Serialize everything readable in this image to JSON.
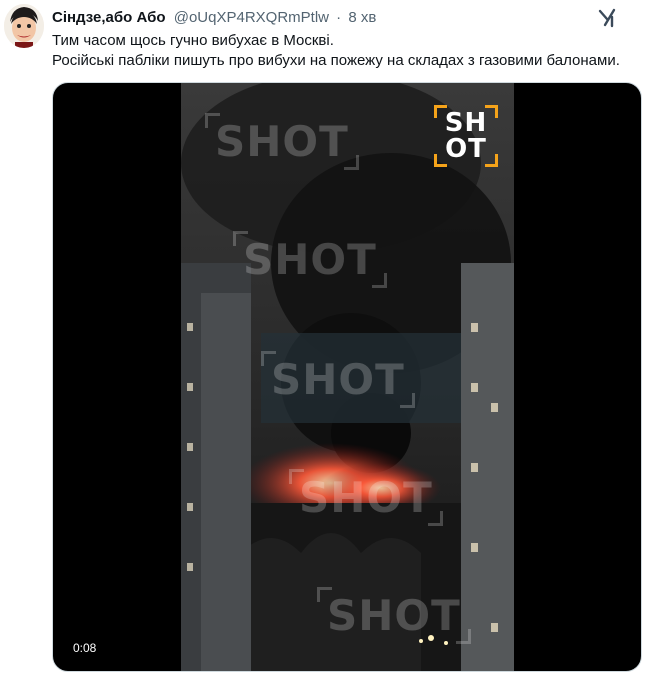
{
  "tweet": {
    "author_name": "Сіндзе,або Або",
    "handle": "@oUqXP4RXQRmPtlw",
    "separator": "·",
    "time": "8 хв",
    "text_line1": "Тим часом щось гучно вибухає в Москві.",
    "text_line2": "Російські пабліки пишуть про вибухи на пожежу на складах з газовими балонами."
  },
  "media": {
    "duration": "0:08",
    "logo_line1": "SH",
    "logo_line2": "OT",
    "watermark": "SHOT"
  },
  "icons": {
    "grok": "grok-icon",
    "avatar": "avatar-cartoon"
  }
}
